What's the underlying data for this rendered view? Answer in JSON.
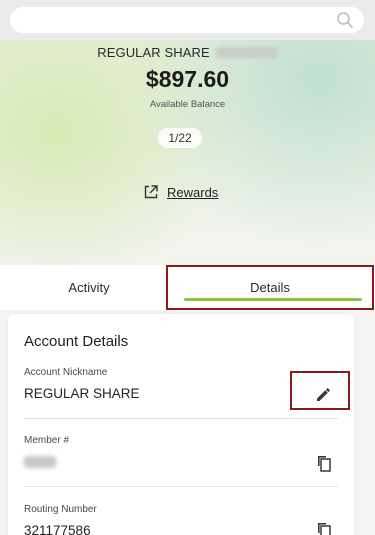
{
  "search": {
    "placeholder": ""
  },
  "account": {
    "name": "REGULAR SHARE",
    "balance": "$897.60",
    "balance_label": "Available Balance",
    "pager": "1/22",
    "rewards_label": "Rewards"
  },
  "tabs": [
    {
      "label": "Activity",
      "selected": false
    },
    {
      "label": "Details",
      "selected": true
    }
  ],
  "details": {
    "title": "Account Details",
    "nickname_label": "Account Nickname",
    "nickname_value": "REGULAR SHARE",
    "member_label": "Member #",
    "routing_label": "Routing Number",
    "routing_value": "321177586"
  },
  "colors": {
    "accent": "#8bc53f",
    "highlight_box": "#8b1a1a"
  },
  "icons": {
    "search": "search-icon",
    "rewards": "external-link-icon",
    "edit": "pencil-icon",
    "copy": "copy-icon"
  }
}
